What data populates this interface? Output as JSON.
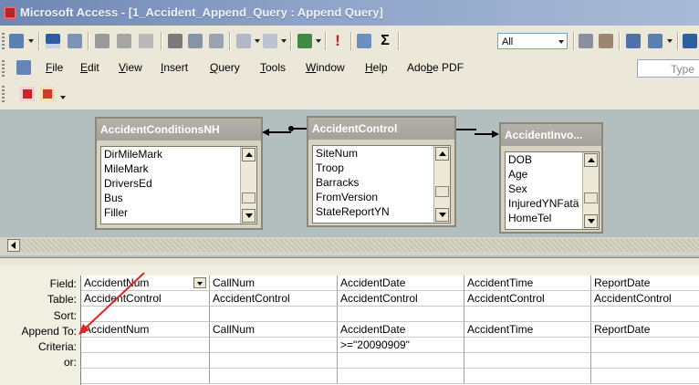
{
  "window": {
    "title": "Microsoft Access - [1_Accident_Append_Query : Append Query]"
  },
  "menubar": {
    "items": [
      {
        "label": "File",
        "mnemonic": "F"
      },
      {
        "label": "Edit",
        "mnemonic": "E"
      },
      {
        "label": "View",
        "mnemonic": "V"
      },
      {
        "label": "Insert",
        "mnemonic": "I"
      },
      {
        "label": "Query",
        "mnemonic": "Q"
      },
      {
        "label": "Tools",
        "mnemonic": "T"
      },
      {
        "label": "Window",
        "mnemonic": "W"
      },
      {
        "label": "Help",
        "mnemonic": "H"
      },
      {
        "label": "Adobe PDF",
        "mnemonic": "b"
      }
    ],
    "help_box_text": "Type"
  },
  "toolbar": {
    "top_values_combo": "All",
    "totals_label": "Σ",
    "run_label": "!"
  },
  "tables": [
    {
      "name": "AccidentConditionsNH",
      "fields": [
        "DirMileMark",
        "MileMark",
        "DriversEd",
        "Bus",
        "Filler"
      ]
    },
    {
      "name": "AccidentControl",
      "fields": [
        "SiteNum",
        "Troop",
        "Barracks",
        "FromVersion",
        "StateReportYN"
      ]
    },
    {
      "name": "AccidentInvo...",
      "fields": [
        "DOB",
        "Age",
        "Sex",
        "InjuredYNFatä",
        "HomeTel"
      ]
    }
  ],
  "grid": {
    "row_labels": [
      "Field:",
      "Table:",
      "Sort:",
      "Append To:",
      "Criteria:",
      "or:"
    ],
    "columns": [
      {
        "field": "AccidentNum",
        "table": "AccidentControl",
        "sort": "",
        "append_to": "AccidentNum",
        "criteria": "",
        "or": ""
      },
      {
        "field": "CallNum",
        "table": "AccidentControl",
        "sort": "",
        "append_to": "CallNum",
        "criteria": "",
        "or": ""
      },
      {
        "field": "AccidentDate",
        "table": "AccidentControl",
        "sort": "",
        "append_to": "AccidentDate",
        "criteria": ">=\"20090909\"",
        "or": ""
      },
      {
        "field": "AccidentTime",
        "table": "AccidentControl",
        "sort": "",
        "append_to": "AccidentTime",
        "criteria": "",
        "or": ""
      },
      {
        "field": "ReportDate",
        "table": "AccidentControl",
        "sort": "",
        "append_to": "ReportDate",
        "criteria": "",
        "or": ""
      }
    ]
  },
  "colors": {
    "annotation_arrow": "#e8231f",
    "title_gradient": "#8ea4c8",
    "table_title": "#a3a19a"
  }
}
